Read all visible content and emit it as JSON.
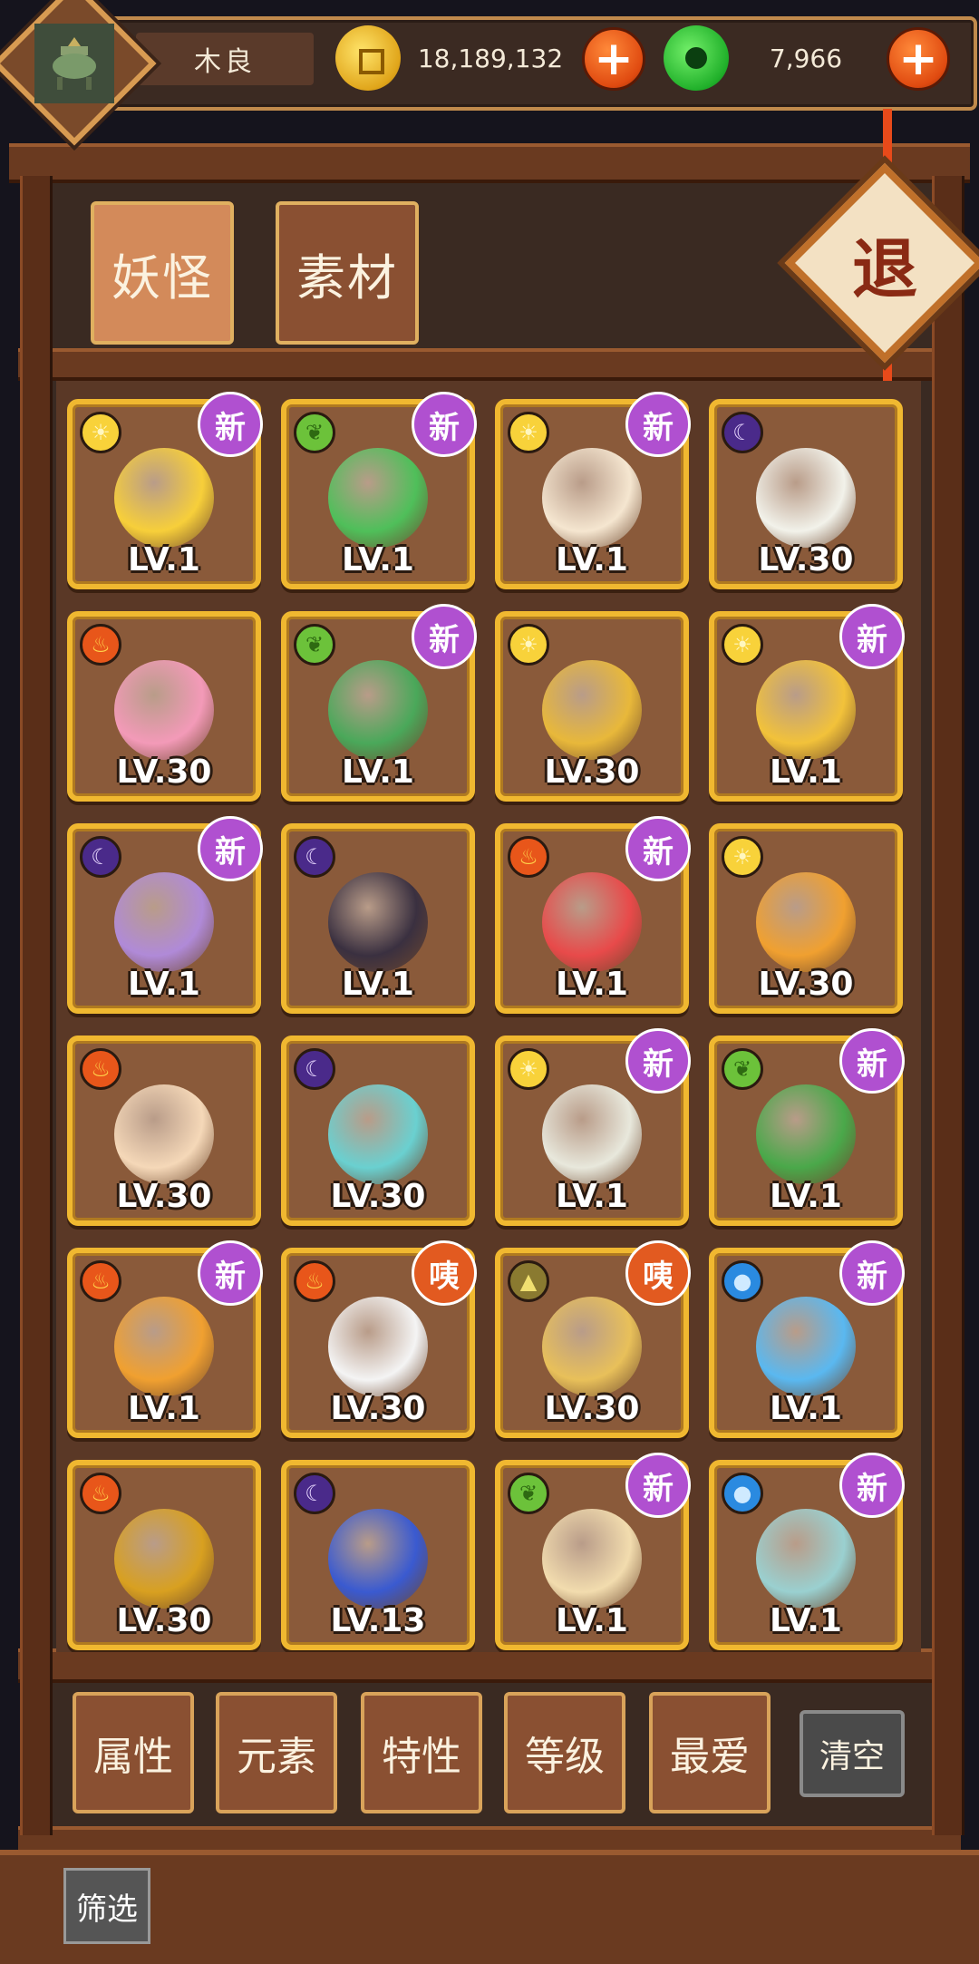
{
  "player": {
    "name": "木良"
  },
  "currency": {
    "gold": {
      "amount": "18,189,132",
      "icon": "gold-coin-icon"
    },
    "jade": {
      "amount": "7,966",
      "icon": "jade-coin-icon"
    },
    "plus_label": "+"
  },
  "tabs": [
    {
      "label": "妖怪",
      "active": true
    },
    {
      "label": "素材",
      "active": false
    }
  ],
  "exit_label": "退",
  "cards": [
    {
      "element": "sun",
      "badge": "新",
      "level": "LV.1",
      "sprite_color": "#f7cf3a"
    },
    {
      "element": "leaf",
      "badge": "新",
      "level": "LV.1",
      "sprite_color": "#4fbf5a"
    },
    {
      "element": "sun",
      "badge": "新",
      "level": "LV.1",
      "sprite_color": "#f5e6d0"
    },
    {
      "element": "moon",
      "badge": "",
      "level": "LV.30",
      "sprite_color": "#f2f2ea"
    },
    {
      "element": "fire",
      "badge": "",
      "level": "LV.30",
      "sprite_color": "#f39ab8"
    },
    {
      "element": "leaf",
      "badge": "新",
      "level": "LV.1",
      "sprite_color": "#4aa85a"
    },
    {
      "element": "sun",
      "badge": "",
      "level": "LV.30",
      "sprite_color": "#e8b83a"
    },
    {
      "element": "sun",
      "badge": "新",
      "level": "LV.1",
      "sprite_color": "#f2c23a"
    },
    {
      "element": "moon",
      "badge": "新",
      "level": "LV.1",
      "sprite_color": "#b08ad8"
    },
    {
      "element": "moon",
      "badge": "",
      "level": "LV.1",
      "sprite_color": "#3a3040"
    },
    {
      "element": "fire",
      "badge": "新",
      "level": "LV.1",
      "sprite_color": "#e84a4a"
    },
    {
      "element": "sun",
      "badge": "",
      "level": "LV.30",
      "sprite_color": "#f0a030"
    },
    {
      "element": "fire",
      "badge": "",
      "level": "LV.30",
      "sprite_color": "#f5d8b8"
    },
    {
      "element": "moon",
      "badge": "",
      "level": "LV.30",
      "sprite_color": "#6ad0d0"
    },
    {
      "element": "sun",
      "badge": "新",
      "level": "LV.1",
      "sprite_color": "#e8e8dc"
    },
    {
      "element": "leaf",
      "badge": "新",
      "level": "LV.1",
      "sprite_color": "#4aa84a"
    },
    {
      "element": "fire",
      "badge": "新",
      "level": "LV.1",
      "sprite_color": "#f0a030"
    },
    {
      "element": "fire",
      "badge": "咦",
      "level": "LV.30",
      "sprite_color": "#f4f4f4"
    },
    {
      "element": "earth",
      "badge": "咦",
      "level": "LV.30",
      "sprite_color": "#e8c05a"
    },
    {
      "element": "water",
      "badge": "新",
      "level": "LV.1",
      "sprite_color": "#5ab8f0"
    },
    {
      "element": "fire",
      "badge": "",
      "level": "LV.30",
      "sprite_color": "#d8a020"
    },
    {
      "element": "moon",
      "badge": "",
      "level": "LV.13",
      "sprite_color": "#3a5ad0"
    },
    {
      "element": "leaf",
      "badge": "新",
      "level": "LV.1",
      "sprite_color": "#f2dcae"
    },
    {
      "element": "water",
      "badge": "新",
      "level": "LV.1",
      "sprite_color": "#9ad0d0"
    }
  ],
  "filters": [
    {
      "label": "属性"
    },
    {
      "label": "元素"
    },
    {
      "label": "特性"
    },
    {
      "label": "等级"
    },
    {
      "label": "最爱"
    }
  ],
  "clear_label": "清空",
  "screen_label": "筛选",
  "element_icons": {
    "sun": "☀",
    "leaf": "❦",
    "fire": "♨",
    "moon": "☾",
    "water": "●",
    "earth": "▲"
  }
}
